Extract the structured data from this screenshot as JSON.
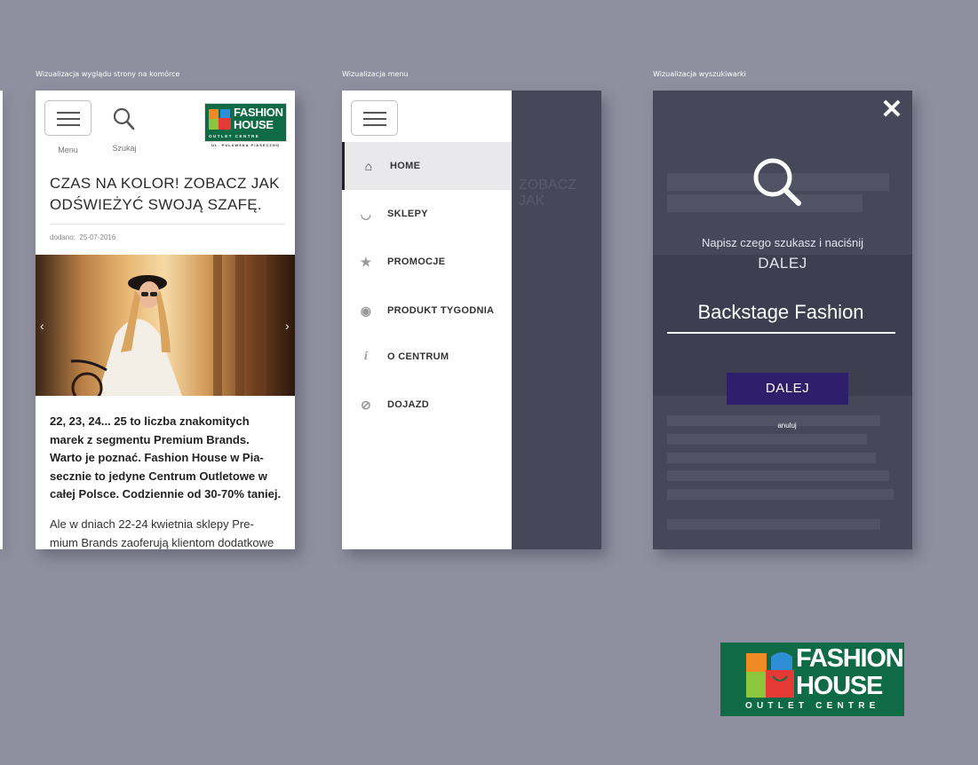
{
  "captions": {
    "page": "Wizualizacja wyglądu strony na komórce",
    "menu": "Wizualizacja menu",
    "search": "Wizualizacja wyszukiwarki"
  },
  "page_screen": {
    "menu_label": "Menu",
    "search_label": "Szukaj",
    "logo": {
      "line1": "FASHION",
      "line2": "HOUSE",
      "line3": "OUTLET CENTRE",
      "address": "UL. PUŁAWSKA PIASECZNO"
    },
    "title_line1": "CZAS NA KOLOR! ZOBACZ JAK",
    "title_line2": "ODŚWIEŻYĆ SWOJĄ SZAFĘ.",
    "date_label": "dodano:",
    "date_value": "25-07-2016",
    "slider_prev": "‹",
    "slider_next": "›",
    "lead_lines": [
      "22, 23, 24... 25 to liczba znakomitych",
      "marek z segmentu Premium Brands.",
      "Warto je poznać. Fashion House w Pia-",
      "secznie to jedyne Centrum Outletowe w",
      "całej Polsce. Codziennie od 30-70% taniej."
    ],
    "body_lines": [
      "Ale w dniach 22-24 kwietnia sklepy Pre-",
      "mium Brands zaoferują klientom dodatkowe"
    ]
  },
  "menu_screen": {
    "items": [
      {
        "label": "HOME",
        "icon": "home-icon",
        "glyph": "⌂",
        "active": true
      },
      {
        "label": "SKLEPY",
        "icon": "basket-icon",
        "glyph": "◡",
        "active": false
      },
      {
        "label": "PROMOCJE",
        "icon": "star-icon",
        "glyph": "★",
        "active": false
      },
      {
        "label": "PRODUKT TYGODNIA",
        "icon": "badge-icon",
        "glyph": "◉",
        "active": false
      },
      {
        "label": "O CENTRUM",
        "icon": "info-icon",
        "glyph": "i",
        "active": false
      },
      {
        "label": "DOJAZD",
        "icon": "compass-icon",
        "glyph": "⊘",
        "active": false
      }
    ]
  },
  "search_screen": {
    "close": "✕",
    "prompt_line1": "Napisz czego szukasz i naciśnij",
    "prompt_line2": "DALEJ",
    "input_value": "Backstage Fashion",
    "submit_label": "DALEJ",
    "cancel_label": "anuluj"
  },
  "big_logo": {
    "line1": "FASHION",
    "line2": "HOUSE",
    "line3": "OUTLET CENTRE"
  },
  "colors": {
    "background": "#8f8f9f",
    "brand_green": "#0e6b45",
    "overlay": "#47475a",
    "button_purple": "#2d1f6b"
  }
}
